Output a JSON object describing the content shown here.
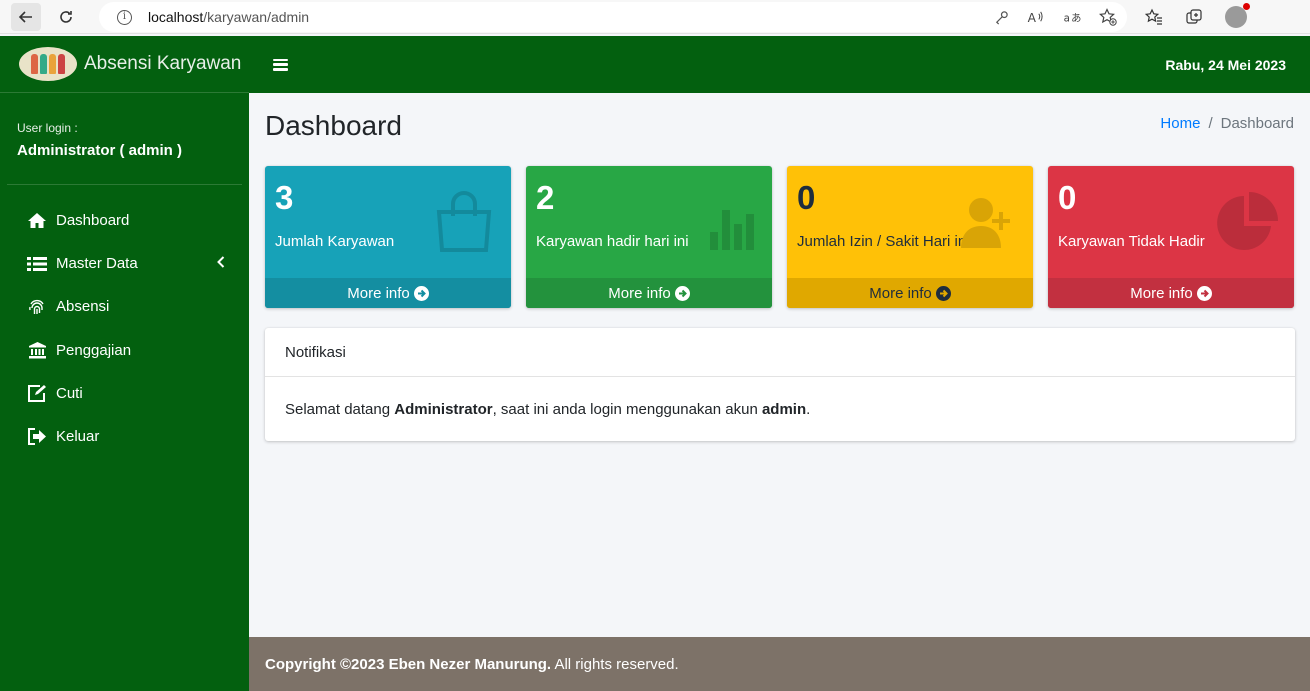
{
  "browser": {
    "url_host": "localhost",
    "url_path": "/karyawan/admin"
  },
  "sidebar": {
    "brand_title": "Absensi Karyawan",
    "user_caption": "User login :",
    "user_name": "Administrator ( admin )",
    "items": [
      {
        "label": "Dashboard",
        "icon": "home-icon"
      },
      {
        "label": "Master Data",
        "icon": "list-icon"
      },
      {
        "label": "Absensi",
        "icon": "fingerprint-icon"
      },
      {
        "label": "Penggajian",
        "icon": "bank-icon"
      },
      {
        "label": "Cuti",
        "icon": "edit-icon"
      },
      {
        "label": "Keluar",
        "icon": "sign-out-icon"
      }
    ]
  },
  "topbar": {
    "date": "Rabu, 24 Mei 2023"
  },
  "page": {
    "title": "Dashboard",
    "breadcrumb": {
      "home": "Home",
      "separator": "/",
      "current": "Dashboard"
    }
  },
  "boxes": [
    {
      "number": "3",
      "label": "Jumlah Karyawan",
      "footer": "More info",
      "icon": "shopping-bag-icon",
      "color": "#17a2b8"
    },
    {
      "number": "2",
      "label": "Karyawan hadir hari ini",
      "footer": "More info",
      "icon": "bar-chart-icon",
      "color": "#28a745"
    },
    {
      "number": "0",
      "label": "Jumlah Izin / Sakit Hari ini",
      "footer": "More info",
      "icon": "user-plus-icon",
      "color": "#ffc107"
    },
    {
      "number": "0",
      "label": "Karyawan Tidak Hadir",
      "footer": "More info",
      "icon": "pie-chart-icon",
      "color": "#dc3545"
    }
  ],
  "notification": {
    "header": "Notifikasi",
    "text_1": "Selamat datang ",
    "bold_1": "Administrator",
    "text_2": ", saat ini anda login menggunakan akun ",
    "bold_2": "admin",
    "text_3": "."
  },
  "footer": {
    "copyright_bold": "Copyright ©2023 Eben Nezer Manurung.",
    "copyright_rest": " All rights reserved."
  }
}
